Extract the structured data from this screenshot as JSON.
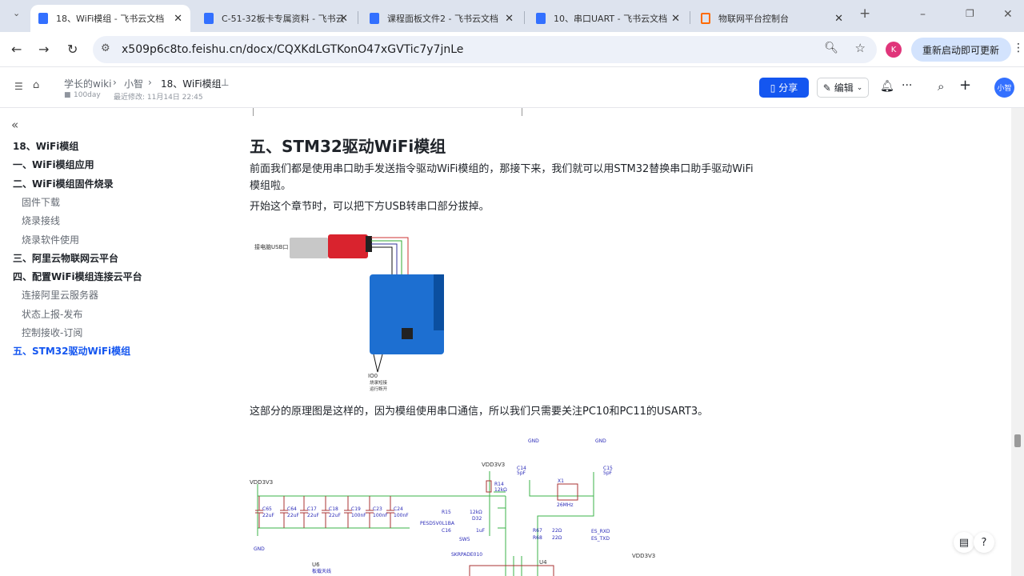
{
  "browser": {
    "tabs": [
      {
        "title": "18、WiFi模组 - 飞书云文档",
        "active": true
      },
      {
        "title": "C-51-32板卡专属资料 - 飞书云"
      },
      {
        "title": "课程面板文件2 - 飞书云文档"
      },
      {
        "title": "10、串口UART - 飞书云文档"
      },
      {
        "title": "物联网平台控制台"
      }
    ],
    "url": "x509p6c8to.feishu.cn/docx/CQXKdLGTKonO47xGVTic7y7jnLe",
    "profile_initial": "K",
    "update_button": "重新启动即可更新"
  },
  "doc_header": {
    "breadcrumb": [
      "学长的wiki",
      "小智",
      "18、WiFi模组"
    ],
    "space": "100day",
    "modified": "最近修改: 11月14日 22:45",
    "share": "分享",
    "edit": "编辑",
    "avatar": "小智"
  },
  "toc": [
    {
      "label": "18、WiFi模组",
      "level": "h"
    },
    {
      "label": "一、WiFi模组应用",
      "level": "h"
    },
    {
      "label": "二、WiFi模组固件烧录",
      "level": "h"
    },
    {
      "label": "固件下载",
      "level": "sub"
    },
    {
      "label": "烧录接线",
      "level": "sub"
    },
    {
      "label": "烧录软件使用",
      "level": "sub"
    },
    {
      "label": "三、阿里云物联网云平台",
      "level": "h"
    },
    {
      "label": "四、配置WiFi模组连接云平台",
      "level": "h"
    },
    {
      "label": "连接阿里云服务器",
      "level": "sub"
    },
    {
      "label": "状态上报-发布",
      "level": "sub"
    },
    {
      "label": "控制接收-订阅",
      "level": "sub"
    },
    {
      "label": "五、STM32驱动WiFi模组",
      "level": "active"
    }
  ],
  "content": {
    "heading": "五、STM32驱动WiFi模组",
    "para1": "前面我们都是使用串口助手发送指令驱动WiFi模组的，那接下来，我们就可以用STM32替换串口助手驱动WiFi模组啦。",
    "para2": "开始这个章节时，可以把下方USB转串口部分拔掉。",
    "figure1": {
      "usb_label": "接电脑USB口",
      "io_label": "IO0",
      "note1": "烧录短接",
      "note2": "运行断开"
    },
    "para3": "这部分的原理图是这样的，因为模组使用串口通信，所以我们只需要关注PC10和PC11的USART3。",
    "schematic": {
      "vdd": "VDD3V3",
      "gnd": "GND",
      "caps": [
        {
          "name": "C65",
          "val": "22uF"
        },
        {
          "name": "C64",
          "val": "22uF"
        },
        {
          "name": "C17",
          "val": "22uF"
        },
        {
          "name": "C18",
          "val": "22uF"
        },
        {
          "name": "C19",
          "val": "100nF"
        },
        {
          "name": "C23",
          "val": "100nF"
        },
        {
          "name": "C24",
          "val": "100nF"
        }
      ],
      "r14": "R14",
      "r14v": "12kΩ",
      "r15": "R15",
      "r15v": "12kΩ",
      "d32": "D32",
      "pesd": "PESD5V0L1BA",
      "c16": "C16",
      "c16v": "1uF",
      "sw5": "SW5",
      "sw_part": "SKRPADE010",
      "x1": "X1",
      "x1v": "26MHz",
      "c14": "C14",
      "c15": "C15",
      "cv": "5pF",
      "r67": "R67",
      "r68": "R68",
      "rv": "22Ω",
      "rxd": "ES_RXD",
      "txd": "ES_TXD",
      "u4": "U4",
      "u6": "U6",
      "u6v": "板载天线"
    }
  }
}
